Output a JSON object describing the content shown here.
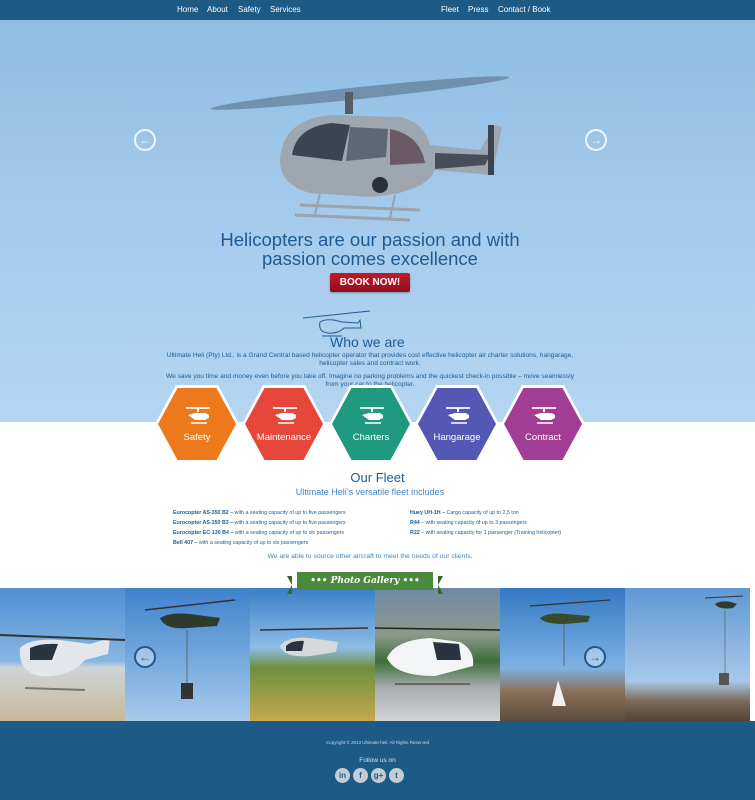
{
  "nav": {
    "left": [
      "Home",
      "About",
      "Safety",
      "Services"
    ],
    "right": [
      "Fleet",
      "Press",
      "Contact / Book"
    ]
  },
  "hero": {
    "headline_line1": "Helicopters are our passion and with",
    "headline_line2": "passion comes excellence",
    "cta": "BOOK NOW!",
    "prev_icon": "chevron-left-circle-icon",
    "next_icon": "chevron-right-circle-icon"
  },
  "about": {
    "title": "Who we are",
    "p1": "Ultimate Heli (Pty) Ltd., is a Grand Central based helicopter operator that provides cost effective helicopter air charter solutions, hangarage, helicopter sales and contract work.",
    "p2": "We save you time and money even before you take off. Imagine no parking problems and the quickest check-in possible – move seamlessly from your car to the helicopter."
  },
  "services": [
    {
      "label": "Safety",
      "color": "#ec7a1c",
      "icon": "helicopter-icon"
    },
    {
      "label": "Maintenance",
      "color": "#e5473b",
      "icon": "helicopter-icon"
    },
    {
      "label": "Charters",
      "color": "#1f9a7f",
      "icon": "helicopter-icon"
    },
    {
      "label": "Hangarage",
      "color": "#5258b3",
      "icon": "helicopter-icon"
    },
    {
      "label": "Contract",
      "color": "#a23d95",
      "icon": "helicopter-icon"
    }
  ],
  "fleet": {
    "title": "Our Fleet",
    "subtitle": "Ultimate Heli’s versatile fleet includes",
    "left": [
      {
        "name": "Eurocopter  AS-350 B2 –",
        "desc": " with a seating capacity of up to five passengers"
      },
      {
        "name": "Eurocopter  AS-350 B3 –",
        "desc": " with a seating capacity of up to five passengers"
      },
      {
        "name": "Eurocopter  EC-130 B4 –",
        "desc": " with a seating capacity of up to six passengers"
      },
      {
        "name": "Bell  407 –",
        "desc": " with a seating capacity of up to six passengers"
      }
    ],
    "right": [
      {
        "name": "Huey UH-1H –",
        "desc": " Cargo capacity of up to 2,5 ton"
      },
      {
        "name": "R44",
        "desc": "  – with seating capacity of up to 3 passengers"
      },
      {
        "name": "R22",
        "desc": " – with seating capacity for 1 passenger (Training helicopter)"
      }
    ],
    "note": "We are able to source other aircraft to meet the needs of our  clients."
  },
  "gallery": {
    "ribbon": "••• Photo Gallery •••",
    "prev_icon": "chevron-left-circle-icon",
    "next_icon": "chevron-right-circle-icon"
  },
  "footer": {
    "copyright": "Copyright © 2013 Ultimate-heli. All Rights Reserved",
    "follow": "Follow us on",
    "social": [
      {
        "icon": "linkedin-icon",
        "glyph": "in"
      },
      {
        "icon": "facebook-icon",
        "glyph": "f"
      },
      {
        "icon": "google-plus-icon",
        "glyph": "g+"
      },
      {
        "icon": "twitter-icon",
        "glyph": "t"
      }
    ]
  }
}
